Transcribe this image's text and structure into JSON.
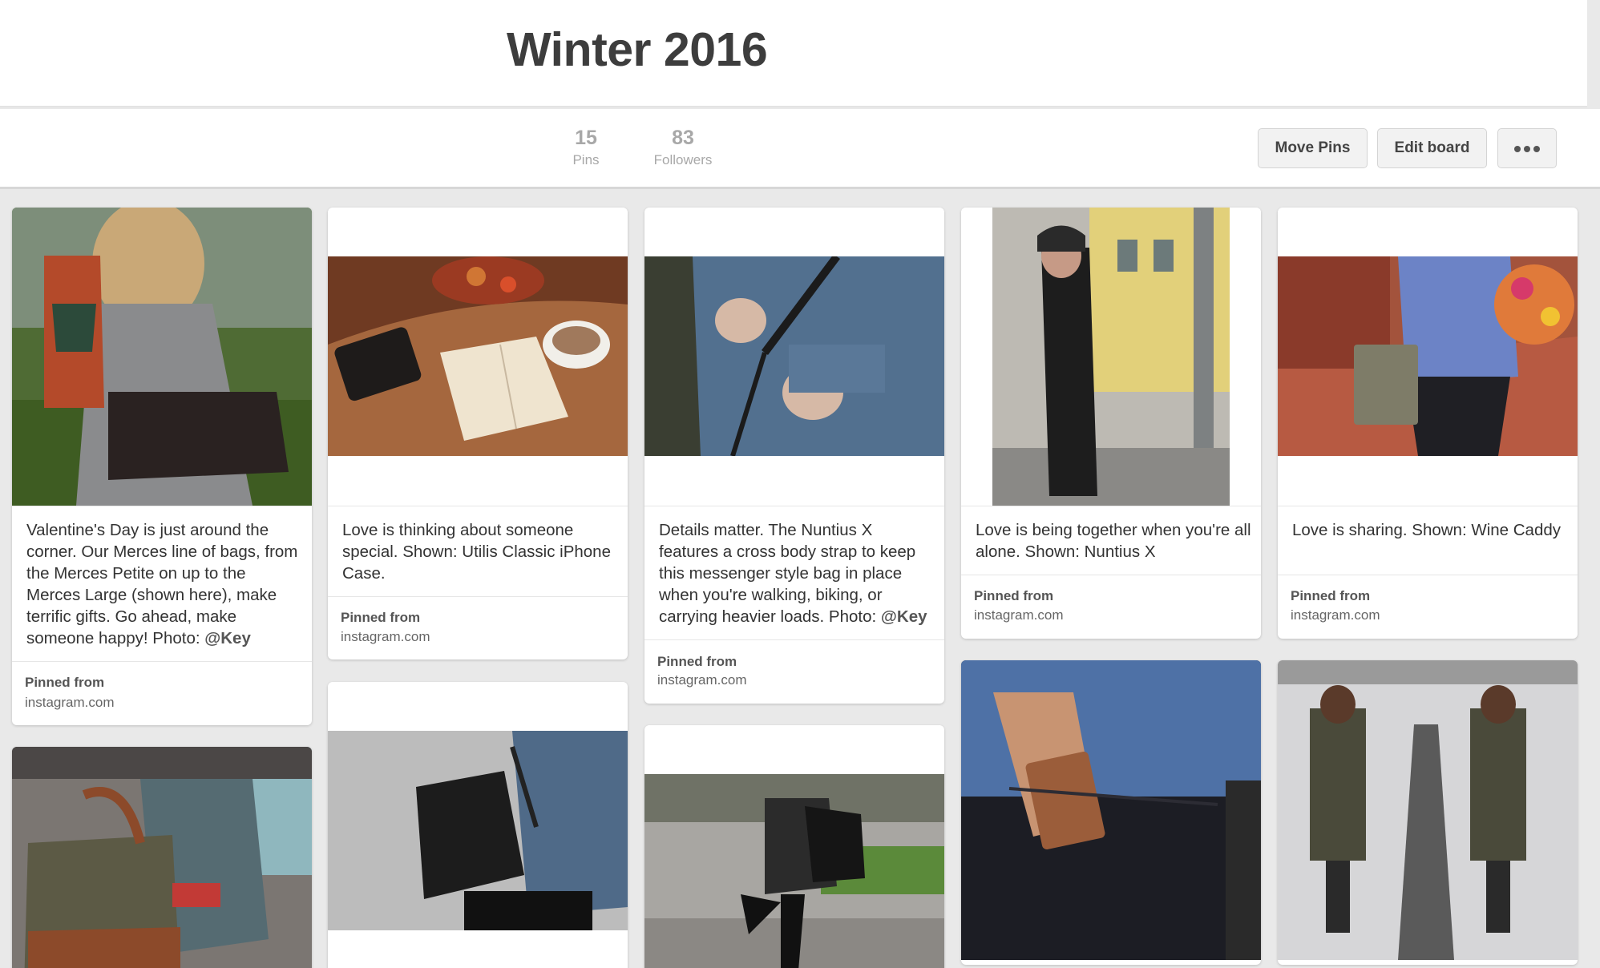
{
  "board": {
    "title": "Winter 2016"
  },
  "stats": {
    "pins": {
      "count": "15",
      "label": "Pins"
    },
    "followers": {
      "count": "83",
      "label": "Followers"
    }
  },
  "actions": {
    "move_pins": "Move Pins",
    "edit_board": "Edit board"
  },
  "pinned_from_label": "Pinned from",
  "pins": [
    {
      "desc": "Valentine's Day is just around the corner. Our Merces line of bags, from the Merces Petite on up to the Merces Large (shown here), make terrific gifts. Go ahead, make someone happy! Photo: ",
      "mention": "@Key",
      "source": "instagram.com"
    },
    {
      "desc": "Love is thinking about someone special. Shown: Utilis Classic iPhone Case.",
      "source": "instagram.com"
    },
    {
      "desc": "Details matter. The Nuntius X features a cross body strap to keep this messenger style bag in place when you're walking, biking, or carrying heavier loads. Photo: ",
      "mention": "@Key",
      "source": "instagram.com"
    },
    {
      "desc": "Love is being together when you're all alone. Shown: Nuntius X",
      "source": "instagram.com"
    },
    {
      "desc": "Love is sharing. Shown: Wine Caddy",
      "source": "instagram.com"
    }
  ]
}
